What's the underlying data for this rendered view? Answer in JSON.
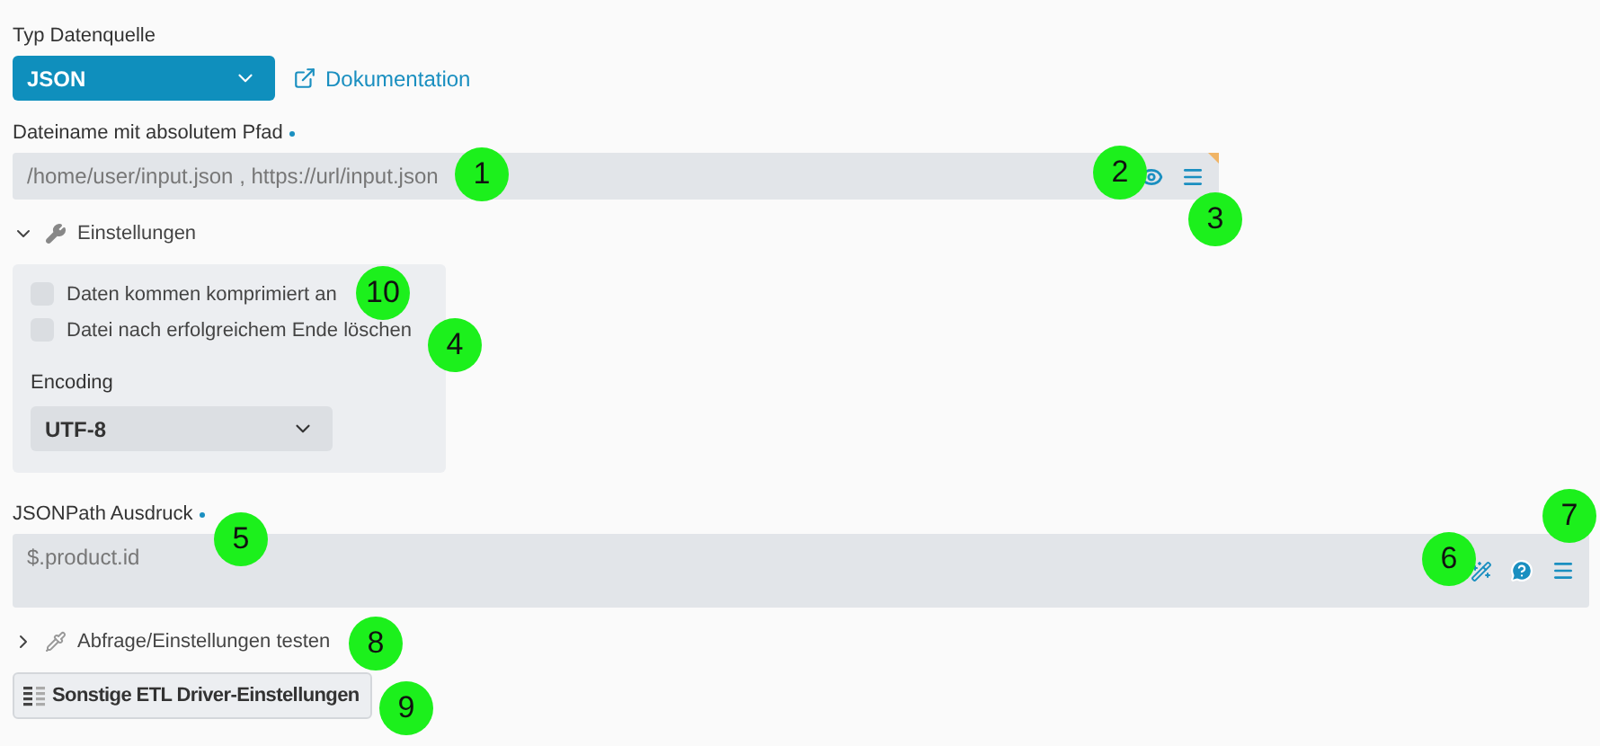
{
  "source_type": {
    "label": "Typ Datenquelle",
    "value": "JSON",
    "doc_link": "Dokumentation"
  },
  "file_path": {
    "label": "Dateiname mit absolutem Pfad",
    "required": true,
    "placeholder": "/home/user/input.json , https://url/input.json"
  },
  "settings": {
    "title": "Einstellungen",
    "expanded": true,
    "checkboxes": [
      {
        "label": "Daten kommen komprimiert an",
        "checked": false
      },
      {
        "label": "Datei nach erfolgreichem Ende löschen",
        "checked": false
      }
    ],
    "encoding": {
      "label": "Encoding",
      "value": "UTF-8"
    }
  },
  "jsonpath": {
    "label": "JSONPath Ausdruck",
    "required": true,
    "placeholder": "$.product.id"
  },
  "test_section": {
    "title": "Abfrage/Einstellungen testen",
    "expanded": false
  },
  "other_button": "Sonstige ETL Driver-Einstellungen",
  "callouts": [
    {
      "label": "1"
    },
    {
      "label": "2"
    },
    {
      "label": "3"
    },
    {
      "label": "10"
    },
    {
      "label": "4"
    },
    {
      "label": "5"
    },
    {
      "label": "6"
    },
    {
      "label": "7"
    },
    {
      "label": "8"
    },
    {
      "label": "9"
    }
  ]
}
